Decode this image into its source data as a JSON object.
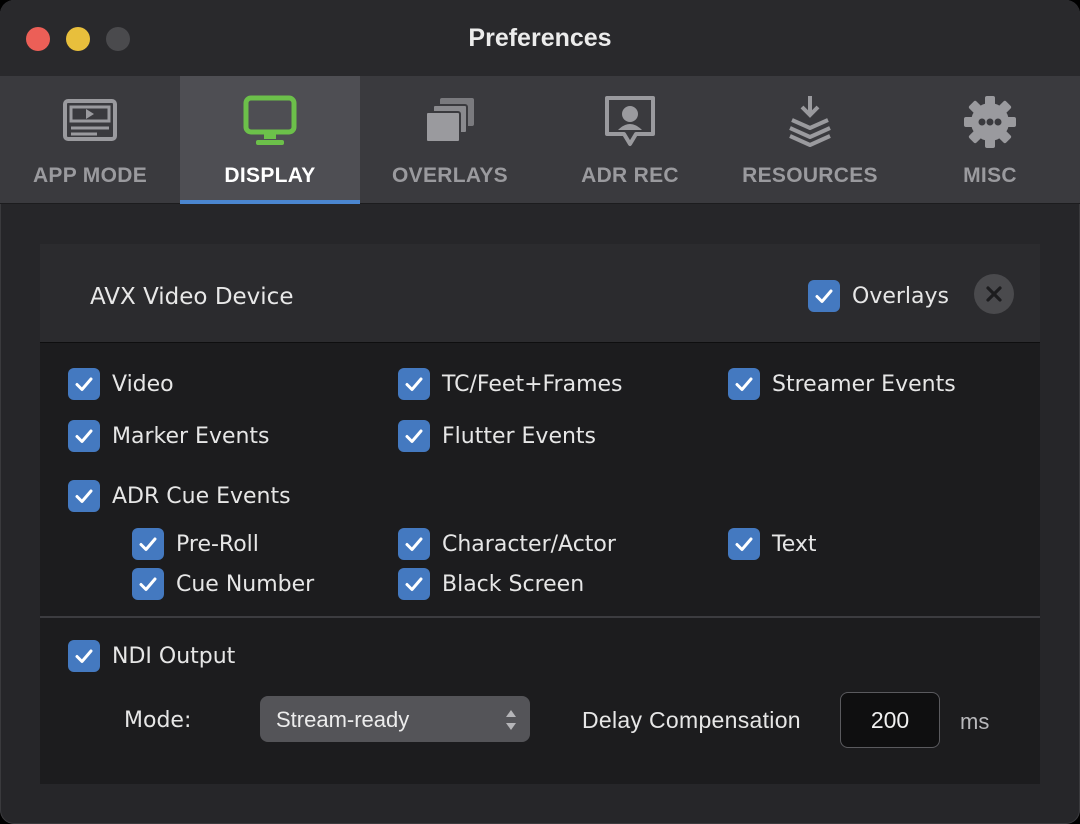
{
  "window": {
    "title": "Preferences"
  },
  "tabs": [
    {
      "label": "APP MODE",
      "icon": "app-mode-icon",
      "active": false
    },
    {
      "label": "DISPLAY",
      "icon": "display-icon",
      "active": true
    },
    {
      "label": "OVERLAYS",
      "icon": "overlays-icon",
      "active": false
    },
    {
      "label": "ADR REC",
      "icon": "adr-rec-icon",
      "active": false
    },
    {
      "label": "RESOURCES",
      "icon": "resources-icon",
      "active": false
    },
    {
      "label": "MISC",
      "icon": "gear-icon",
      "active": false
    }
  ],
  "device": {
    "name": "AVX Video Device",
    "overlays_label": "Overlays",
    "overlays_checked": true
  },
  "options": {
    "video": "Video",
    "tc_feet_frames": "TC/Feet+Frames",
    "streamer_events": "Streamer Events",
    "marker_events": "Marker Events",
    "flutter_events": "Flutter Events",
    "adr_cue_events": "ADR Cue Events",
    "pre_roll": "Pre-Roll",
    "character_actor": "Character/Actor",
    "text": "Text",
    "cue_number": "Cue Number",
    "black_screen": "Black Screen"
  },
  "ndi": {
    "output_label": "NDI Output",
    "mode_label": "Mode:",
    "mode_value": "Stream-ready",
    "delay_label": "Delay Compensation",
    "delay_value": "200",
    "delay_unit": "ms"
  },
  "colors": {
    "accent": "#4b86d0",
    "checkbox": "#4479c0",
    "display_icon": "#6cc04a"
  }
}
